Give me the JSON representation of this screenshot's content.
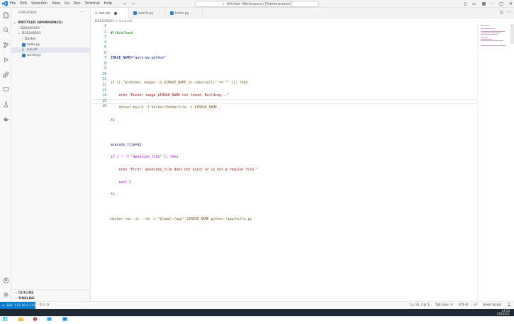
{
  "titlebar": {
    "menu": [
      "File",
      "Edit",
      "Selection",
      "View",
      "Go",
      "Run",
      "Terminal",
      "Help"
    ],
    "search_text": "Untitled (Workspace) [Administrator]"
  },
  "sidebar": {
    "title": "EXPLORER",
    "workspace": "UNTITLED (WORKSPACE)",
    "folder1": "D20240329",
    "folder2": "D20240501",
    "files": [
      {
        "name": "Docker",
        "icon": "docker-file-icon"
      },
      {
        "name": "hello.py",
        "icon": "python-file-icon"
      },
      {
        "name": "run.sh",
        "icon": "shell-file-icon"
      },
      {
        "name": "world.py",
        "icon": "python-file-icon"
      }
    ],
    "outline": "OUTLINE",
    "timeline": "TIMELINE"
  },
  "tabs": [
    {
      "label": "run.sh",
      "active": true
    },
    {
      "label": "world.py",
      "active": false
    },
    {
      "label": "hello.py",
      "active": false
    }
  ],
  "breadcrumb": "D20240501 > $ run.sh",
  "editor": {
    "line_numbers": [
      "1",
      "2",
      "3",
      "4",
      "5",
      "6",
      "7",
      "8",
      "9",
      "10",
      "11",
      "12",
      "13",
      "14",
      "15",
      "16"
    ],
    "lines": [
      "#!/bin/bash",
      "",
      "IMAGE_NAME=\"auto-my-python\"",
      "",
      "if [[ \"$(docker images -q $IMAGE_NAME 2> /dev/null)\" == \"\" ]]; then",
      "    echo \"Docker image $IMAGE_NAME not found. Building...\"",
      "    docker build -f Docker/Dockerfile -t $IMAGE_NAME .",
      "fi",
      "",
      "execute_file=$1",
      "if [ ! -f \"$execute_file\" ]; then",
      "    echo \"Error: $execute_file does not exist or is not a regular file.\"",
      "    exit 1",
      "fi",
      "",
      "docker run -it --rm -v \"$(pwd):/app\" $IMAGE_NAME python /app/hello.py"
    ]
  },
  "status": {
    "remote": "SSH: 172.16.0.213",
    "problems": "0 ⚠ 0",
    "position": "Ln 16, Col 1",
    "spaces": "Tab Size: 4",
    "encoding": "UTF-8",
    "eol": "LF",
    "language": "Shell Script"
  },
  "taskbar": {
    "time": "14:50",
    "date": "2024/5/1"
  }
}
